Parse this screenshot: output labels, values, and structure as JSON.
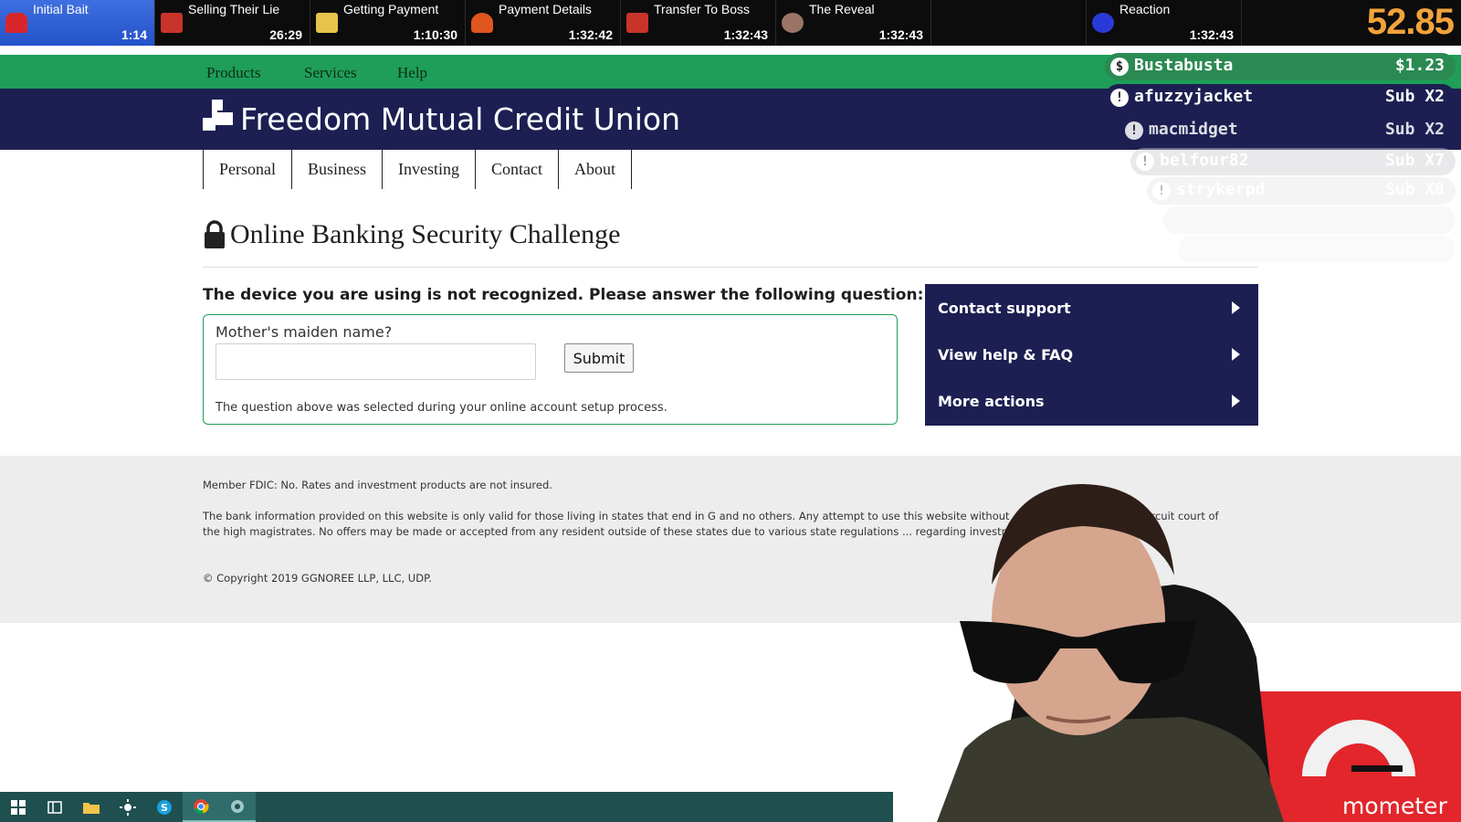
{
  "splits": [
    {
      "name": "Initial Bait",
      "time": "1:14",
      "active": true,
      "icon": "siren-icon",
      "color": "#d9262c"
    },
    {
      "name": "Selling Their Lie",
      "time": "26:29",
      "active": false,
      "icon": "wallet-icon",
      "color": "#c8342a"
    },
    {
      "name": "Getting Payment",
      "time": "1:10:30",
      "active": false,
      "icon": "money-icon",
      "color": "#e7c24d"
    },
    {
      "name": "Payment Details",
      "time": "1:32:42",
      "active": false,
      "icon": "flame-icon",
      "color": "#e0561f"
    },
    {
      "name": "Transfer To Boss",
      "time": "1:32:43",
      "active": false,
      "icon": "wallet-icon",
      "color": "#c8342a"
    },
    {
      "name": "The Reveal",
      "time": "1:32:43",
      "active": false,
      "icon": "sunglasses-face-icon",
      "color": "#9a7566"
    },
    {
      "name": "Reaction",
      "time": "1:32:43",
      "active": false,
      "icon": "monster-face-icon",
      "color": "#2a3ad8"
    }
  ],
  "timer": {
    "value": "52.85",
    "color": "#f2a33a"
  },
  "bank": {
    "top_nav": [
      "Products",
      "Services",
      "Help"
    ],
    "name": "Freedom Mutual Credit Union",
    "main_nav": [
      "Personal",
      "Business",
      "Investing",
      "Contact",
      "About"
    ],
    "title": "Online Banking Security Challenge",
    "prompt": "The device you are using is not recognized. Please answer the following question:",
    "question_label": "Mother's maiden name?",
    "answer_value": "",
    "submit_label": "Submit",
    "question_note": "The question above was selected during your online account setup process.",
    "actions": [
      "Contact support",
      "View help & FAQ",
      "More actions"
    ],
    "footer": {
      "fdic": "Member FDIC: No. Rates and investment products are not insured.",
      "disclaimer": "The bank information provided on this website is only valid for those living in states that end in G and no others. Any attempt to use this website without ... as stated by the 11th circuit court of the high magistrates. No offers may be made or accepted from any resident outside of these states due to various state regulations ... regarding investment products and services.",
      "copyright": "© Copyright 2019 GGNOREE LLP, LLC, UDP."
    },
    "colors": {
      "green": "#1e9e58",
      "navy": "#1d1f52"
    }
  },
  "events": [
    {
      "name": "Bustabusta",
      "amount": "$1.23",
      "icon": "dollar-icon"
    },
    {
      "name": "afuzzyjacket",
      "amount": "Sub X2",
      "icon": "alert-icon"
    },
    {
      "name": "macmidget",
      "amount": "Sub X2",
      "icon": "alert-icon"
    },
    {
      "name": "belfour82",
      "amount": "Sub X7",
      "icon": "alert-icon"
    },
    {
      "name": "strykerpd",
      "amount": "Sub X8",
      "icon": "alert-icon"
    }
  ],
  "stream_brand": "mometer",
  "taskbar": [
    {
      "icon": "windows-start-icon"
    },
    {
      "icon": "task-view-icon"
    },
    {
      "icon": "file-explorer-icon"
    },
    {
      "icon": "brightness-icon"
    },
    {
      "icon": "skype-icon"
    },
    {
      "icon": "chrome-icon",
      "active": true
    },
    {
      "icon": "app-icon",
      "active": true
    }
  ]
}
